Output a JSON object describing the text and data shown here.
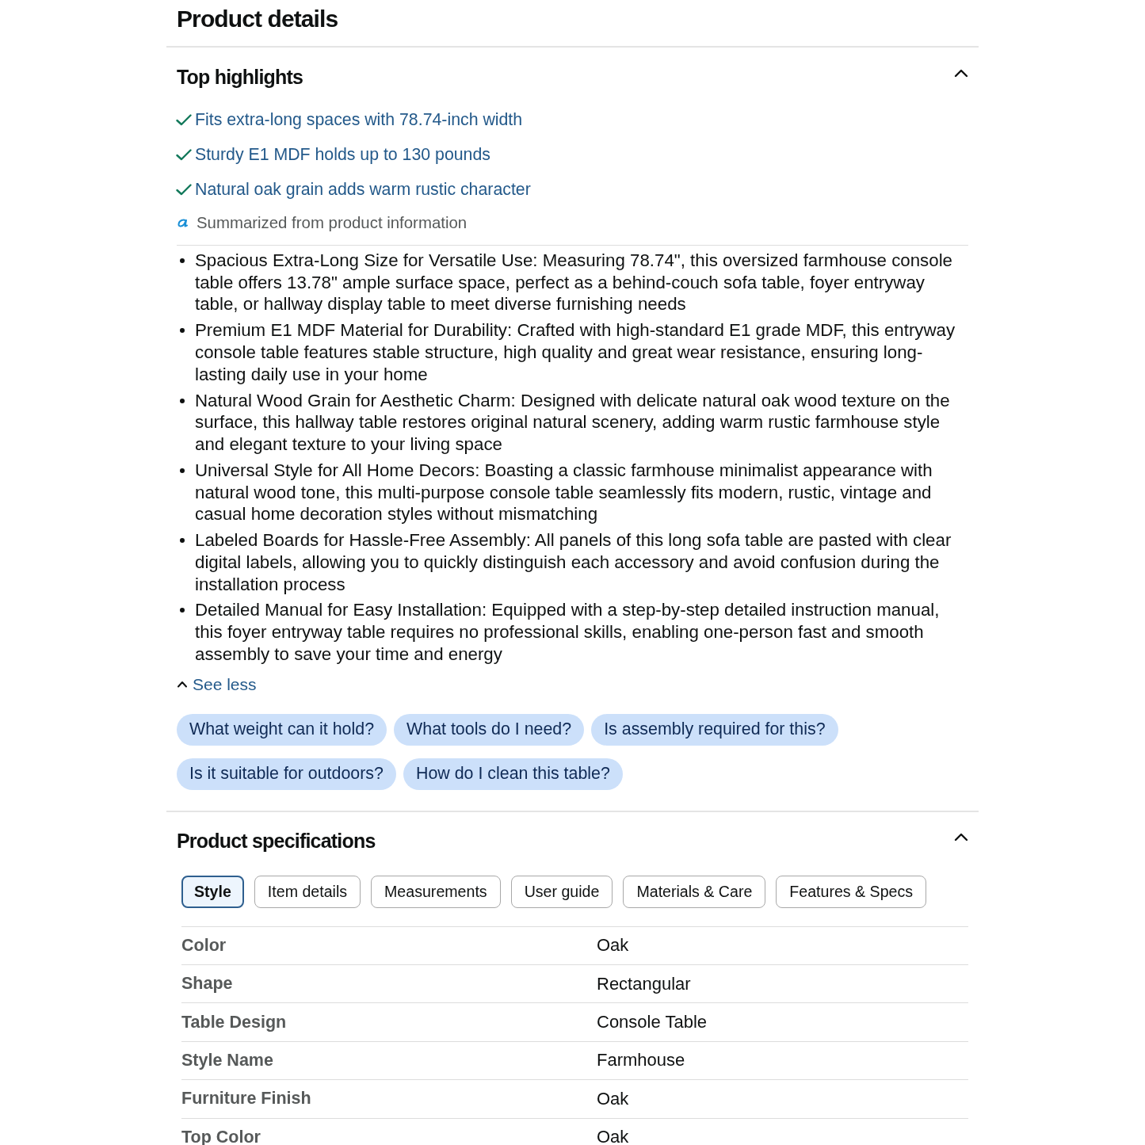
{
  "page": {
    "title": "Product details"
  },
  "highlights": {
    "title": "Top highlights",
    "expanded": true,
    "items": [
      "Fits extra-long spaces with 78.74-inch width",
      "Sturdy E1 MDF holds up to 130 pounds",
      "Natural oak grain adds warm rustic character"
    ],
    "source_note": "Summarized from product information"
  },
  "about_bullets": [
    "Spacious Extra-Long Size for Versatile Use: Measuring 78.74\", this oversized farmhouse console table offers 13.78\" ample surface space, perfect as a behind-couch sofa table, foyer entryway table, or hallway display table to meet diverse furnishing needs",
    "Premium E1 MDF Material for Durability: Crafted with high-standard E1 grade MDF, this entryway console table features stable structure, high quality and great wear resistance, ensuring long-lasting daily use in your home",
    "Natural Wood Grain for Aesthetic Charm: Designed with delicate natural oak wood texture on the surface, this hallway table restores original natural scenery, adding warm rustic farmhouse style and elegant texture to your living space",
    "Universal Style for All Home Decors: Boasting a classic farmhouse minimalist appearance with natural wood tone, this multi-purpose console table seamlessly fits modern, rustic, vintage and casual home decoration styles without mismatching",
    "Labeled Boards for Hassle-Free Assembly: All panels of this long sofa table are pasted with clear digital labels, allowing you to quickly distinguish each accessory and avoid confusion during the installation process",
    "Detailed Manual for Easy Installation: Equipped with a step-by-step detailed instruction manual, this foyer entryway table requires no professional skills, enabling one-person fast and smooth assembly to save your time and energy"
  ],
  "see_less": {
    "label": "See less"
  },
  "questions": [
    "What weight can it hold?",
    "What tools do I need?",
    "Is assembly required for this?",
    "Is it suitable for outdoors?",
    "How do I clean this table?"
  ],
  "specifications": {
    "title": "Product specifications",
    "expanded": true,
    "tabs": [
      {
        "label": "Style",
        "selected": true
      },
      {
        "label": "Item details",
        "selected": false
      },
      {
        "label": "Measurements",
        "selected": false
      },
      {
        "label": "User guide",
        "selected": false
      },
      {
        "label": "Materials & Care",
        "selected": false
      },
      {
        "label": "Features & Specs",
        "selected": false
      }
    ],
    "rows": [
      {
        "label": "Color",
        "value": "Oak"
      },
      {
        "label": "Shape",
        "value": "Rectangular"
      },
      {
        "label": "Table Design",
        "value": "Console Table"
      },
      {
        "label": "Style Name",
        "value": "Farmhouse"
      },
      {
        "label": "Furniture Finish",
        "value": "Oak"
      },
      {
        "label": "Top Color",
        "value": "Oak"
      }
    ]
  }
}
